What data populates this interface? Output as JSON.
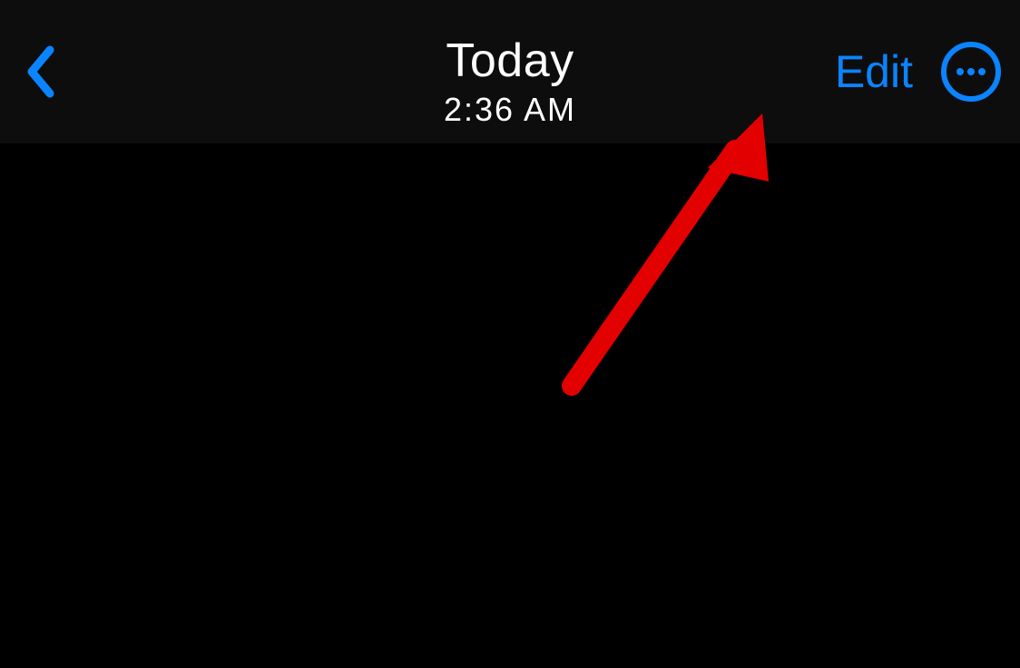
{
  "header": {
    "title": "Today",
    "subtitle": "2:36 AM",
    "edit_label": "Edit"
  },
  "colors": {
    "accent": "#0a84ff",
    "annotation": "#e30000"
  }
}
